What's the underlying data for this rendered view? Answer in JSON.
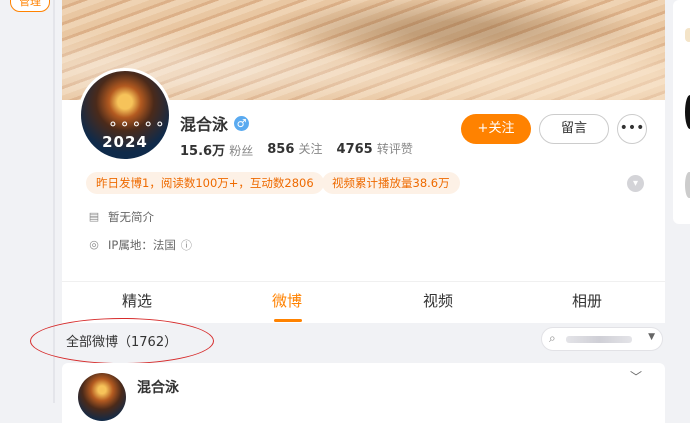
{
  "nav": {
    "manage_label": "管理"
  },
  "profile": {
    "avatar_text": "2024",
    "name": "混合泳",
    "gender_icon": "male-icon",
    "followers_value": "15.6万",
    "followers_label": "粉丝",
    "following_value": "856",
    "following_label": "关注",
    "likes_value": "4765",
    "likes_label": "转评赞",
    "follow_button": "+关注",
    "message_button": "留言",
    "more_button": "•••",
    "tags": [
      "昨日发博1，阅读数100万+，互动数2806",
      "视频累计播放量38.6万"
    ],
    "bio": "暂无简介",
    "ip_location": "IP属地：法国"
  },
  "tabs": [
    {
      "label": "精选",
      "active": false
    },
    {
      "label": "微博",
      "active": true
    },
    {
      "label": "视频",
      "active": false
    },
    {
      "label": "相册",
      "active": false
    }
  ],
  "feed": {
    "header": "全部微博（1762）",
    "search_placeholder": ""
  },
  "post": {
    "author": "混合泳"
  },
  "colors": {
    "accent": "#ff8200",
    "annotation": "#d62b2b"
  }
}
